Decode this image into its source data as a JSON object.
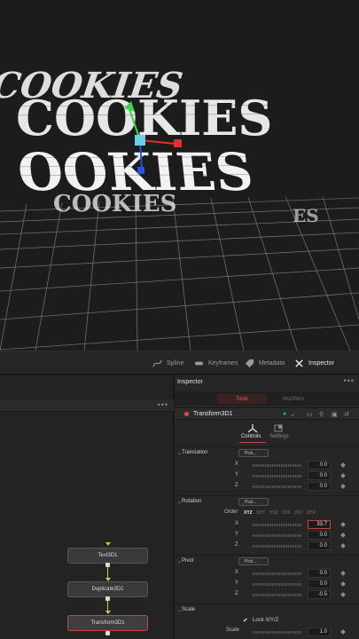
{
  "toolbar": {
    "items": [
      {
        "label": "Spline",
        "icon": "spline-icon"
      },
      {
        "label": "Keyframes",
        "icon": "keyframes-icon"
      },
      {
        "label": "Metadata",
        "icon": "metadata-icon"
      },
      {
        "label": "Inspector",
        "icon": "inspector-icon",
        "active": true
      }
    ]
  },
  "viewer": {
    "title_text": "COOKIES"
  },
  "nodes": {
    "menu": "•••",
    "items": [
      {
        "label": "Text3D1"
      },
      {
        "label": "Duplicate3D1"
      },
      {
        "label": "Transform3D1",
        "selected": true
      }
    ]
  },
  "inspector": {
    "title": "Inspector",
    "menu": "•••",
    "tabs": [
      "Tools",
      "Modifiers"
    ],
    "tool_name": "Transform3D1",
    "tool_color": "#d94a4a",
    "subtabs": [
      "Controls",
      "Settings"
    ],
    "translation": {
      "title": "Translation",
      "pick": "Pick...",
      "x_label": "X",
      "x": "0.0",
      "y_label": "Y",
      "y": "0.0",
      "z_label": "Z",
      "z": "0.0"
    },
    "rotation": {
      "title": "Rotation",
      "pick": "Pick...",
      "order_label": "Order",
      "orders": [
        "XYZ",
        "XZY",
        "YXZ",
        "YZX",
        "ZXY",
        "ZYX"
      ],
      "x_label": "X",
      "x": "33.7",
      "y_label": "Y",
      "y": "0.0",
      "z_label": "Z",
      "z": "0.0"
    },
    "pivot": {
      "title": "Pivot",
      "pick": "Pick...",
      "x_label": "X",
      "x": "0.0",
      "y_label": "Y",
      "y": "0.0",
      "z_label": "Z",
      "z": "-0.5"
    },
    "scale": {
      "title": "Scale",
      "lock_label": "Lock X/Y/Z",
      "scale_label": "Scale",
      "scale": "1.0"
    }
  },
  "colors": {
    "accent_red": "#c24a4a",
    "link_yellow": "#d7c43a"
  }
}
